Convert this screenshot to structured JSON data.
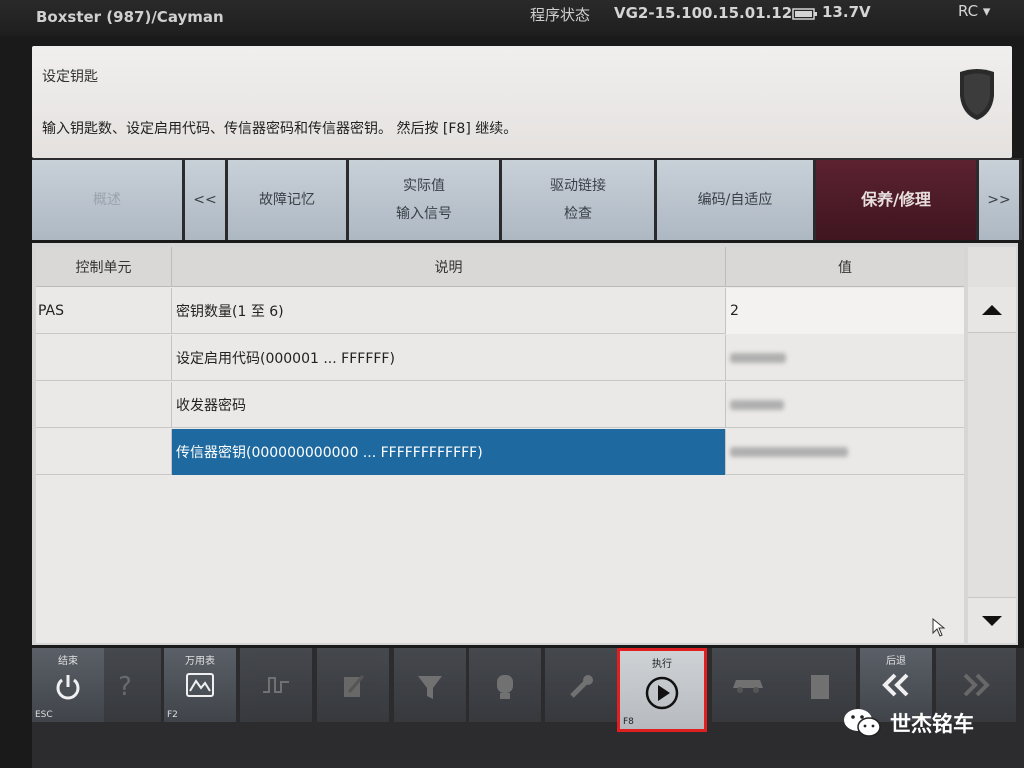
{
  "topbar": {
    "vehicle": "Boxster (987)/Cayman",
    "status_label": "程序状态",
    "version": "VG2-15.100.15.01.12",
    "voltage": "13.7V",
    "rc": "RC ▾"
  },
  "header": {
    "subtitle": "设定钥匙",
    "instruction": "输入钥匙数、设定启用代码、传信器密码和传信器密钥。 然后按 [F8] 继续。"
  },
  "tabs": [
    {
      "line1": "概述",
      "line2": ""
    },
    {
      "line1": "<<",
      "line2": ""
    },
    {
      "line1": "故障记忆",
      "line2": ""
    },
    {
      "line1": "实际值",
      "line2": "输入信号"
    },
    {
      "line1": "驱动链接",
      "line2": "检查"
    },
    {
      "line1": "编码/自适应",
      "line2": ""
    },
    {
      "line1": "保养/修理",
      "line2": ""
    },
    {
      "line1": ">>",
      "line2": ""
    }
  ],
  "table": {
    "headers": [
      "控制单元",
      "说明",
      "值"
    ],
    "rows": [
      {
        "unit": "PAS",
        "desc": "密钥数量(1 至 6)",
        "value": "2"
      },
      {
        "unit": "",
        "desc": "设定启用代码(000001 ... FFFFFF)",
        "value": ""
      },
      {
        "unit": "",
        "desc": "收发器密码",
        "value": ""
      },
      {
        "unit": "",
        "desc": "传信器密钥(000000000000 ... FFFFFFFFFFFF)",
        "value": ""
      }
    ]
  },
  "toolbar": {
    "exit": {
      "label": "结束",
      "key": "ESC"
    },
    "help": {
      "label": "",
      "key": ""
    },
    "multimeter": {
      "label": "万用表",
      "key": "F2"
    },
    "execute": {
      "label": "执行",
      "key": "F8"
    },
    "back": {
      "label": "后退",
      "key": ""
    }
  },
  "watermark": "世杰铭车",
  "colors": {
    "selected_row": "#1e6aa0",
    "active_tab": "#4a1a26",
    "highlight_border": "#e02020"
  }
}
